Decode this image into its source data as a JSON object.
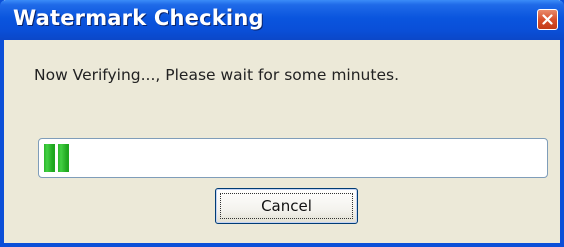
{
  "window": {
    "title": "Watermark Checking",
    "close_icon": "close-icon"
  },
  "dialog": {
    "message": "Now Verifying..., Please wait for some minutes.",
    "progress_fraction": 0.055,
    "cancel_label": "Cancel"
  },
  "colors": {
    "titlebar": "#0A55DE",
    "close_button": "#D8502C",
    "progress_fill": "#2BB52B",
    "dialog_background": "#ECE9D8"
  }
}
